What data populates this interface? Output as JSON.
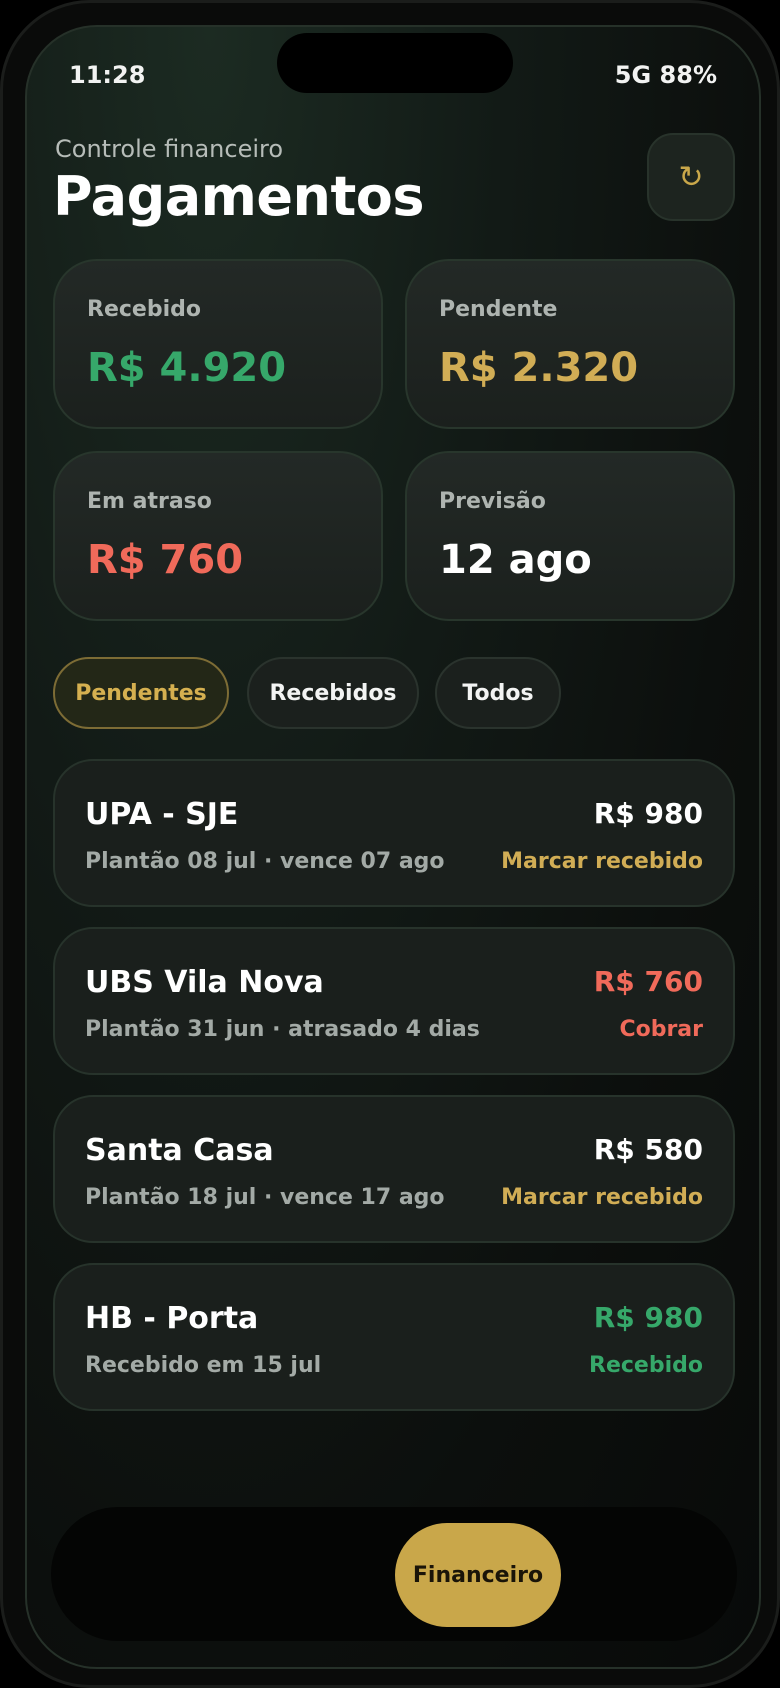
{
  "colors": {
    "accent": "#c9a74a",
    "green": "#36a86a",
    "red": "#f06a5a",
    "gold": "#d1ad55",
    "white": "#ffffff"
  },
  "status_bar": {
    "time": "11:28",
    "network": "5G 88%"
  },
  "header": {
    "subtitle": "Controle financeiro",
    "title": "Pagamentos",
    "refresh_icon": "↻"
  },
  "summary": [
    {
      "label": "Recebido",
      "value": "R$ 4.920",
      "color": "#36a86a"
    },
    {
      "label": "Pendente",
      "value": "R$ 2.320",
      "color": "#d1ad55"
    },
    {
      "label": "Em atraso",
      "value": "R$ 760",
      "color": "#f06a5a"
    },
    {
      "label": "Previsão",
      "value": "12 ago",
      "color": "#ffffff"
    }
  ],
  "tabs": [
    {
      "label": "Pendentes",
      "active": true
    },
    {
      "label": "Recebidos",
      "active": false
    },
    {
      "label": "Todos",
      "active": false
    }
  ],
  "payments": [
    {
      "name": "UPA - SJE",
      "detail": "Plantão 08 jul · vence 07 ago",
      "amount": "R$ 980",
      "amount_color": "#ffffff",
      "action": "Marcar recebido",
      "action_color": "#d1ad55"
    },
    {
      "name": "UBS Vila Nova",
      "detail": "Plantão 31 jun · atrasado 4 dias",
      "amount": "R$ 760",
      "amount_color": "#f06a5a",
      "action": "Cobrar",
      "action_color": "#f06a5a"
    },
    {
      "name": "Santa Casa",
      "detail": "Plantão 18 jul · vence 17 ago",
      "amount": "R$ 580",
      "amount_color": "#ffffff",
      "action": "Marcar recebido",
      "action_color": "#d1ad55"
    },
    {
      "name": "HB - Porta",
      "detail": "Recebido em 15 jul",
      "amount": "R$ 980",
      "amount_color": "#36a86a",
      "action": "Recebido",
      "action_color": "#36a86a"
    }
  ],
  "nav": {
    "active_label": "Financeiro"
  }
}
